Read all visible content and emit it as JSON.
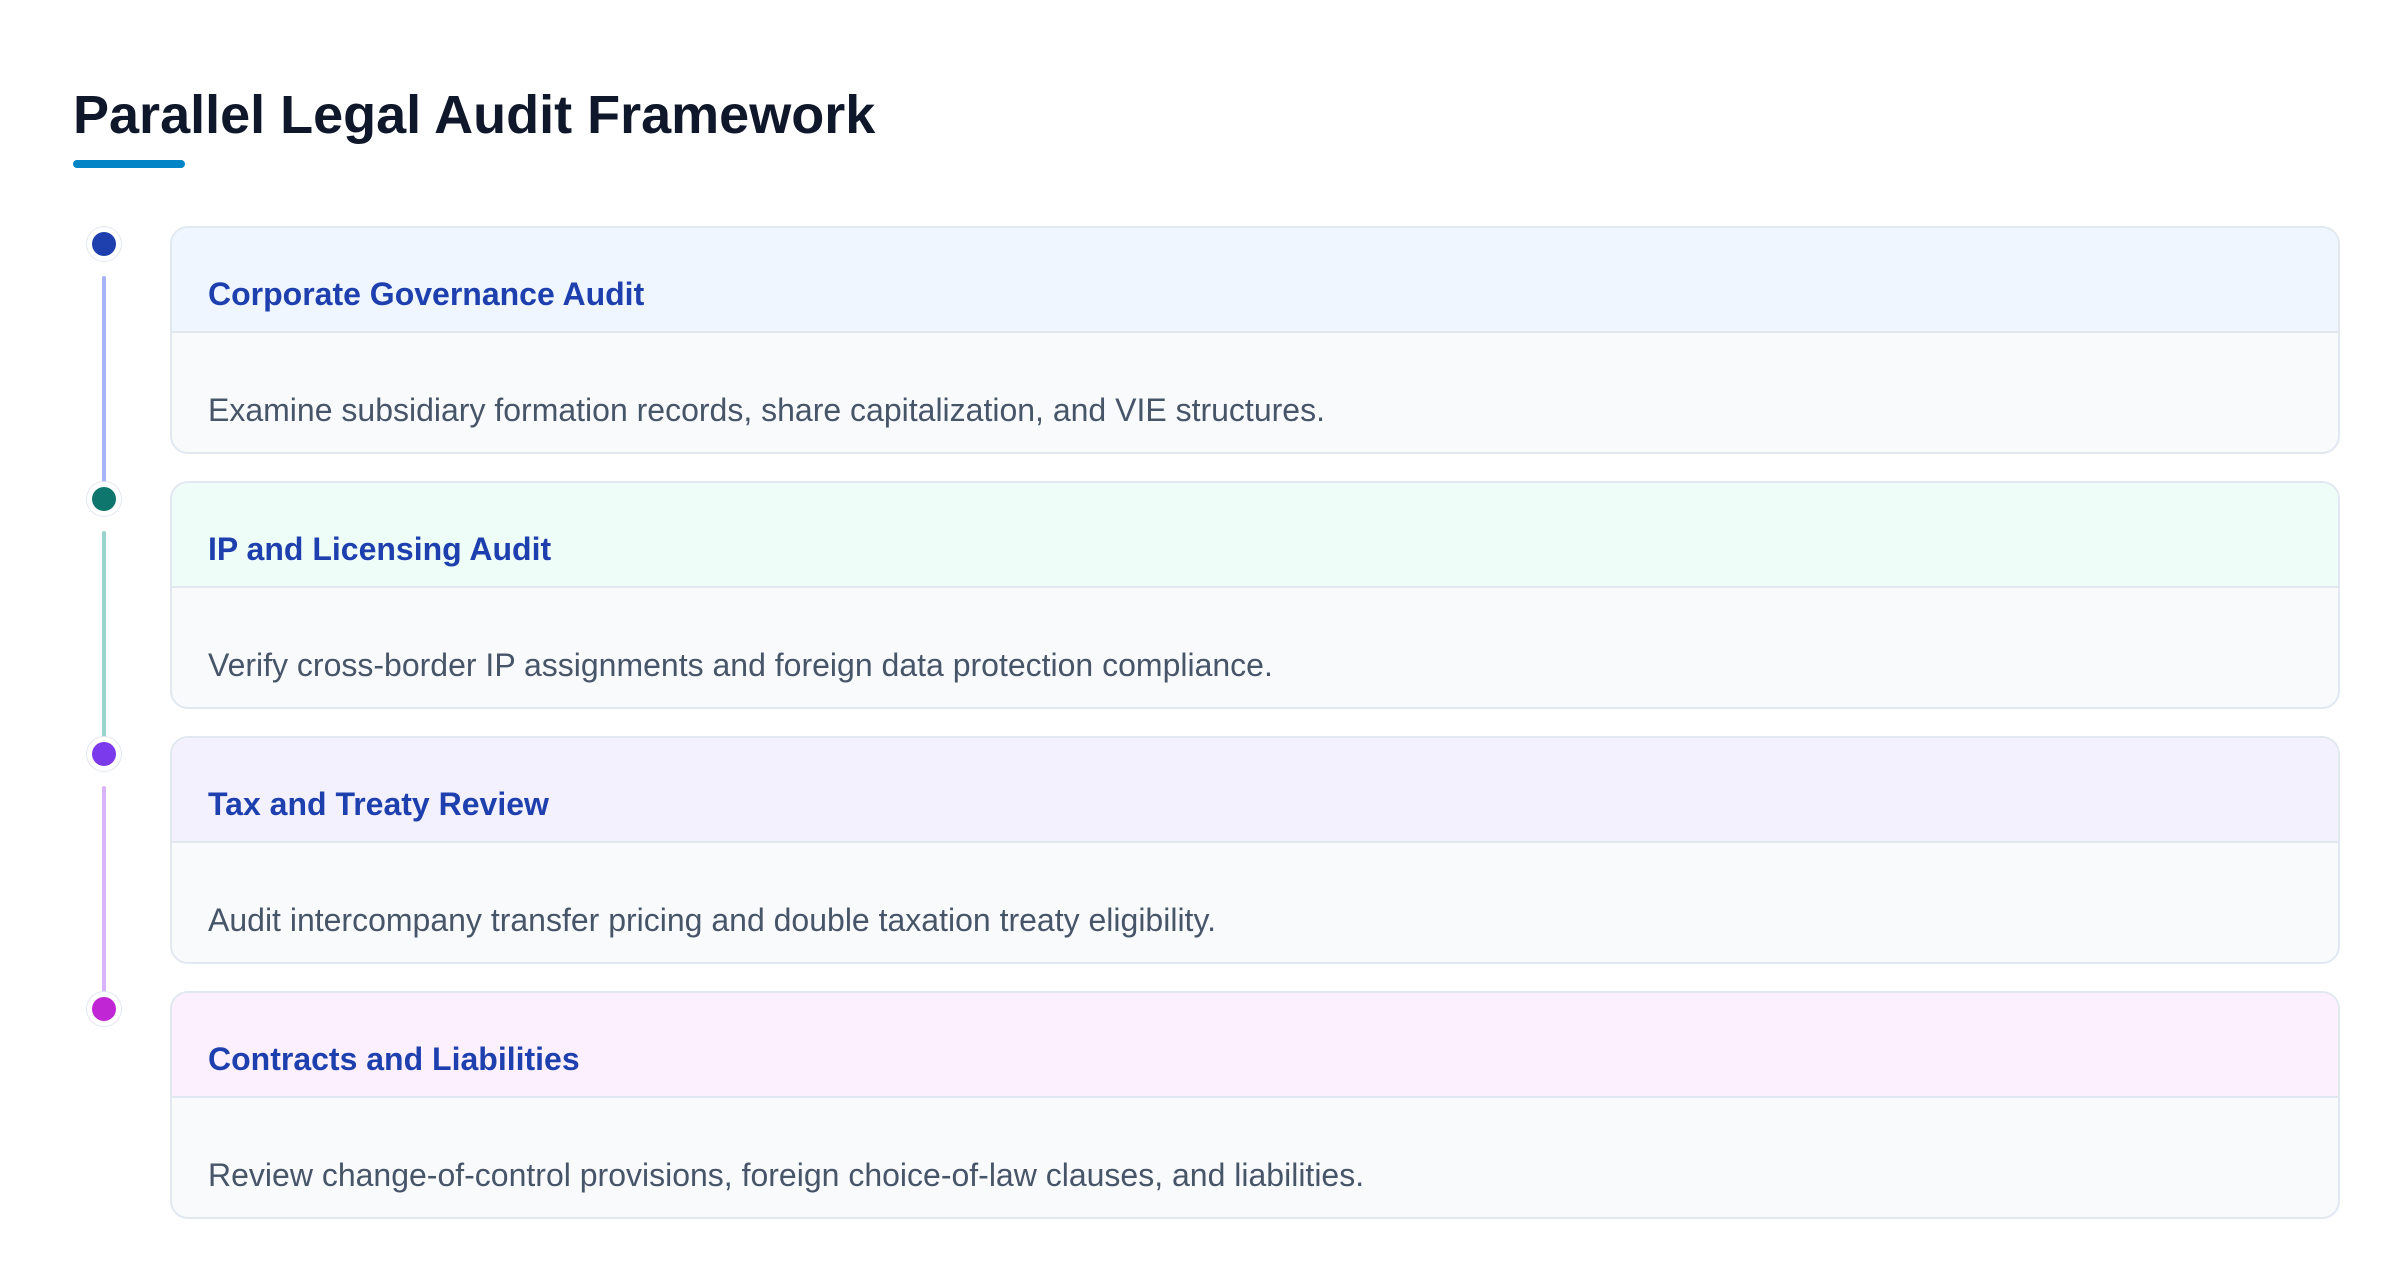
{
  "title": "Parallel Legal Audit Framework",
  "accent_color": "#0284c7",
  "steps": [
    {
      "title": "Corporate Governance Audit",
      "description": "Examine subsidiary formation records, share capitalization, and VIE structures.",
      "dot_color": "#1e40af",
      "line_color": "#a5b4fc",
      "header_bg": "#eff6ff"
    },
    {
      "title": "IP and Licensing Audit",
      "description": "Verify cross-border IP assignments and foreign data protection compliance.",
      "dot_color": "#0f766e",
      "line_color": "#99d5cc",
      "header_bg": "#effdf8"
    },
    {
      "title": "Tax and Treaty Review",
      "description": "Audit intercompany transfer pricing and double taxation treaty eligibility.",
      "dot_color": "#7c3aed",
      "line_color": "#d8b4fe",
      "header_bg": "#f4f1fe"
    },
    {
      "title": "Contracts and Liabilities",
      "description": "Review change-of-control provisions, foreign choice-of-law clauses, and liabilities.",
      "dot_color": "#c026d3",
      "line_color": "#f0abfc",
      "header_bg": "#fdf0fe"
    }
  ]
}
